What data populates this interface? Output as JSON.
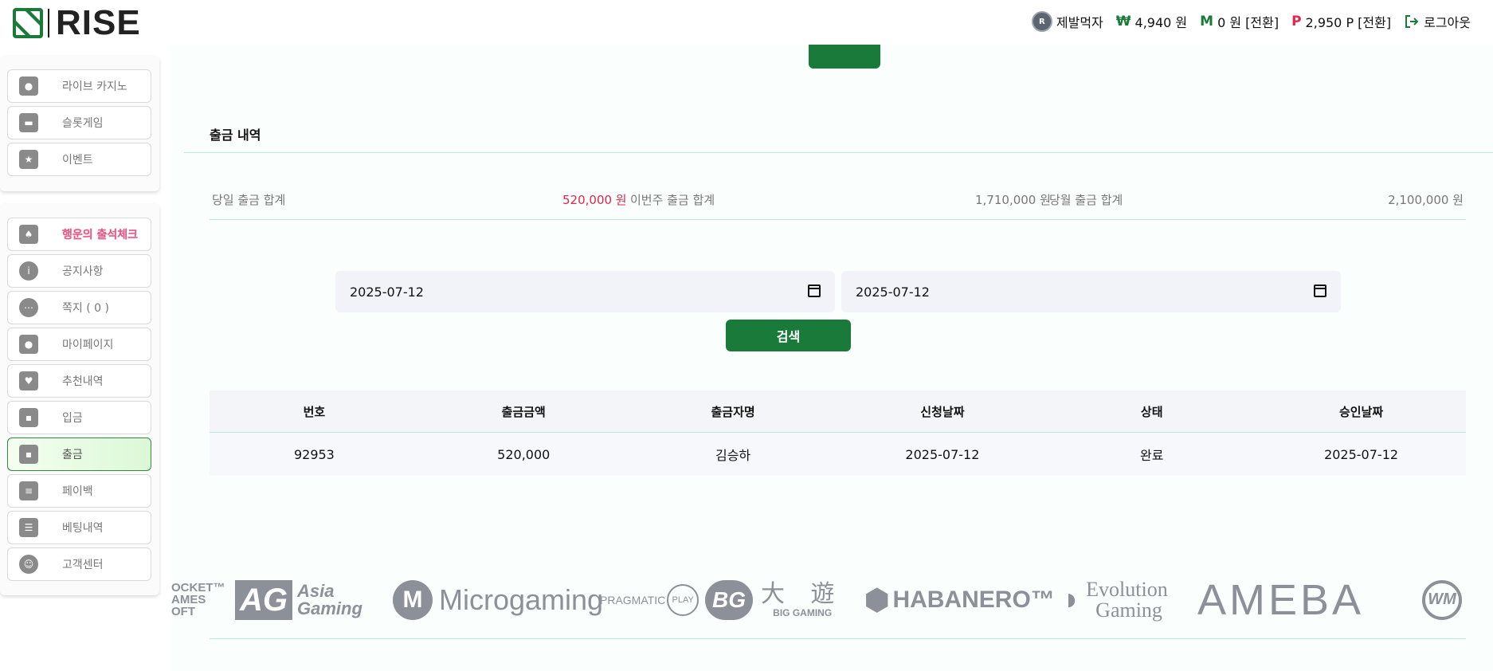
{
  "brand": {
    "name": "RISE",
    "accent": "#1a7a3a",
    "red": "#e0264d"
  },
  "header": {
    "username": "제발먹자",
    "won_symbol": "₩",
    "balance": "4,940 원",
    "m_symbol": "M",
    "m_balance": "0 원 [전환]",
    "p_symbol": "P",
    "points": "2,950 P [전환]",
    "logout": "로그아웃"
  },
  "sidebar": {
    "group1": [
      {
        "label": "라이브 카지노",
        "icon": "casino-chips-icon"
      },
      {
        "label": "슬롯게임",
        "icon": "slot-machine-icon"
      },
      {
        "label": "이벤트",
        "icon": "star-icon"
      }
    ],
    "group2": [
      {
        "label": "행운의 출석체크",
        "icon": "calendar-icon"
      },
      {
        "label": "공지사항",
        "icon": "info-icon"
      },
      {
        "label": "쪽지 ( 0 )",
        "icon": "chat-icon"
      },
      {
        "label": "마이페이지",
        "icon": "user-icon"
      },
      {
        "label": "추천내역",
        "icon": "heart-icon"
      },
      {
        "label": "입금",
        "icon": "wallet-icon"
      },
      {
        "label": "출금",
        "icon": "wallet-icon"
      },
      {
        "label": "페이백",
        "icon": "coins-icon"
      },
      {
        "label": "베팅내역",
        "icon": "list-icon"
      },
      {
        "label": "고객센터",
        "icon": "headset-icon"
      }
    ]
  },
  "main": {
    "section_title": "출금 내역",
    "summary": {
      "today_label": "당일 출금 합계",
      "today_value": "520,000 원",
      "week_label": "이번주 출금 합계",
      "week_value": "1,710,000 원",
      "month_label": "당월 출금 합계",
      "month_value": "2,100,000 원"
    },
    "date_from": "2025-07-12",
    "date_to": "2025-07-12",
    "search_label": "검색",
    "table": {
      "headers": [
        "번호",
        "출금금액",
        "출금자명",
        "신청날짜",
        "상태",
        "승인날짜"
      ],
      "rows": [
        [
          "92953",
          "520,000",
          "김승하",
          "2025-07-12",
          "완료",
          "2025-07-12"
        ]
      ]
    }
  },
  "providers": {
    "rocket": "OCKET™",
    "rocket2": "AMES",
    "rocket3": "OFT",
    "ag": "AG",
    "ag_sub1": "Asia",
    "ag_sub2": "Gaming",
    "microgaming": "Microgaming",
    "pragmatic": "PRAGMATIC",
    "pragmatic_play": "PLAY",
    "bg": "BG",
    "bg_cn": "大 遊",
    "bg_sub": "BIG GAMING",
    "habanero": "HABANERO™",
    "evolution1": "Evolution",
    "evolution2": "Gaming",
    "ameba": "AMEBA",
    "wm": "WM"
  }
}
